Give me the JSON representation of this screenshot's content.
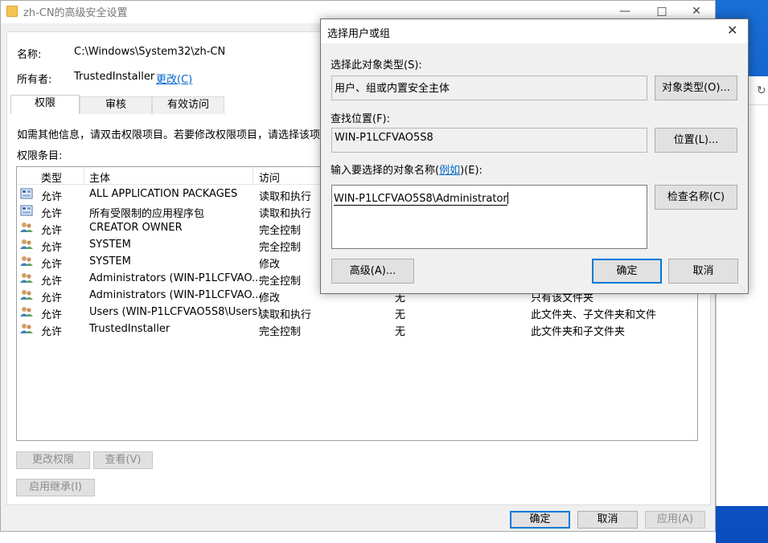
{
  "main_window": {
    "title": "zh-CN的高级安全设置",
    "name_label": "名称:",
    "name_value": "C:\\Windows\\System32\\zh-CN",
    "owner_label": "所有者:",
    "owner_value": "TrustedInstaller",
    "owner_change_link": "更改(C)",
    "tabs": [
      {
        "label": "权限",
        "active": true
      },
      {
        "label": "审核",
        "active": false
      },
      {
        "label": "有效访问",
        "active": false
      }
    ],
    "info_text": "如需其他信息，请双击权限项目。若要修改权限项目，请选择该项",
    "entries_label": "权限条目:",
    "columns": [
      "类型",
      "主体",
      "访问"
    ],
    "rows": [
      {
        "icon": "package-icon",
        "type": "允许",
        "principal": "ALL APPLICATION PACKAGES",
        "access": "读取和执行",
        "inherited": "",
        "applies": ""
      },
      {
        "icon": "package-icon",
        "type": "允许",
        "principal": "所有受限制的应用程序包",
        "access": "读取和执行",
        "inherited": "",
        "applies": ""
      },
      {
        "icon": "users-icon",
        "type": "允许",
        "principal": "CREATOR OWNER",
        "access": "完全控制",
        "inherited": "",
        "applies": ""
      },
      {
        "icon": "users-icon",
        "type": "允许",
        "principal": "SYSTEM",
        "access": "完全控制",
        "inherited": "",
        "applies": ""
      },
      {
        "icon": "users-icon",
        "type": "允许",
        "principal": "SYSTEM",
        "access": "修改",
        "inherited": "",
        "applies": ""
      },
      {
        "icon": "users-icon",
        "type": "允许",
        "principal": "Administrators (WIN-P1LCFVAO...",
        "access": "完全控制",
        "inherited": "",
        "applies": ""
      },
      {
        "icon": "users-icon",
        "type": "允许",
        "principal": "Administrators (WIN-P1LCFVAO...",
        "access": "修改",
        "inherited": "无",
        "applies": "只有该文件夹"
      },
      {
        "icon": "users-icon",
        "type": "允许",
        "principal": "Users (WIN-P1LCFVAO5S8\\Users)",
        "access": "读取和执行",
        "inherited": "无",
        "applies": "此文件夹、子文件夹和文件"
      },
      {
        "icon": "users-icon",
        "type": "允许",
        "principal": "TrustedInstaller",
        "access": "完全控制",
        "inherited": "无",
        "applies": "此文件夹和子文件夹"
      }
    ],
    "btn_change_permissions": "更改权限",
    "btn_view": "查看(V)",
    "btn_enable_inheritance": "启用继承(I)",
    "btn_ok": "确定",
    "btn_cancel": "取消",
    "btn_apply": "应用(A)"
  },
  "dialog": {
    "title": "选择用户或组",
    "object_type_label": "选择此对象类型(S):",
    "object_type_value": "用户、组或内置安全主体",
    "object_type_button": "对象类型(O)...",
    "location_label": "查找位置(F):",
    "location_value": "WIN-P1LCFVAO5S8",
    "location_button": "位置(L)...",
    "names_label_prefix": "输入要选择的对象名称(",
    "names_label_link": "例如",
    "names_label_suffix": ")(E):",
    "names_value": "WIN-P1LCFVAO5S8\\Administrator",
    "check_names_button": "检查名称(C)",
    "advanced_button": "高级(A)...",
    "ok_button": "确定",
    "cancel_button": "取消"
  },
  "colors": {
    "accent": "#0078d7",
    "link": "#0066cc",
    "desktop": "#0b55c4"
  }
}
